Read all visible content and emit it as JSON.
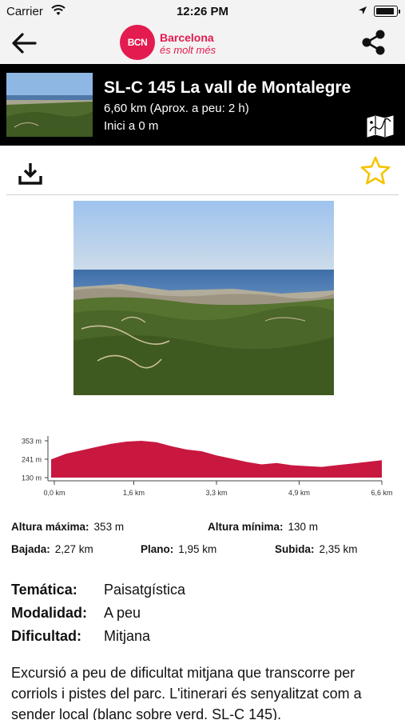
{
  "status_bar": {
    "carrier": "Carrier",
    "time": "12:26 PM"
  },
  "nav": {
    "logo_badge": "BCN",
    "logo_line1": "Barcelona",
    "logo_line2": "és molt més",
    "back_icon": "arrow-left-icon",
    "share_icon": "share-icon"
  },
  "route": {
    "title": "SL-C 145 La vall de Montalegre",
    "distance_line": "6,60 km (Aprox. a peu: 2 h)",
    "start_line": "Inici a 0 m",
    "map_icon": "map-icon"
  },
  "toolbar": {
    "download_icon": "download-icon",
    "favorite_icon": "star-outline-icon"
  },
  "chart_data": {
    "type": "area",
    "y_tick_labels": [
      "353 m",
      "241 m",
      "130 m"
    ],
    "x_tick_labels": [
      "0,0 km",
      "1,6 km",
      "3,3 km",
      "4,9 km",
      "6,6 km"
    ],
    "x": [
      0.0,
      0.3,
      0.6,
      0.9,
      1.2,
      1.5,
      1.8,
      2.1,
      2.4,
      2.7,
      3.0,
      3.3,
      3.6,
      3.9,
      4.2,
      4.5,
      4.8,
      5.1,
      5.4,
      5.7,
      6.0,
      6.3,
      6.6
    ],
    "values": [
      240,
      275,
      295,
      315,
      335,
      348,
      353,
      345,
      320,
      300,
      290,
      265,
      245,
      225,
      210,
      218,
      205,
      200,
      195,
      205,
      215,
      225,
      235
    ],
    "ylim": [
      130,
      353
    ],
    "xlim": [
      0.0,
      6.6
    ],
    "fill_color": "#c8183f",
    "grid": false
  },
  "stats": {
    "max_label": "Altura máxima:",
    "max_value": "353 m",
    "min_label": "Altura mínima:",
    "min_value": "130 m",
    "down_label": "Bajada:",
    "down_value": "2,27 km",
    "flat_label": "Plano:",
    "flat_value": "1,95 km",
    "up_label": "Subida:",
    "up_value": "2,35 km"
  },
  "properties": [
    {
      "label": "Temática:",
      "value": "Paisatgística"
    },
    {
      "label": "Modalidad:",
      "value": "A peu"
    },
    {
      "label": "Dificultad:",
      "value": "Mitjana"
    }
  ],
  "description": "Excursió a peu de dificultat mitjana que transcorre per corriols i pistes del parc. L'itinerari és senyalitzat com a sender local (blanc sobre verd. SL-C 145).",
  "colors": {
    "brand": "#e31b4f",
    "header_bg": "#000000",
    "star": "#f5c400"
  }
}
